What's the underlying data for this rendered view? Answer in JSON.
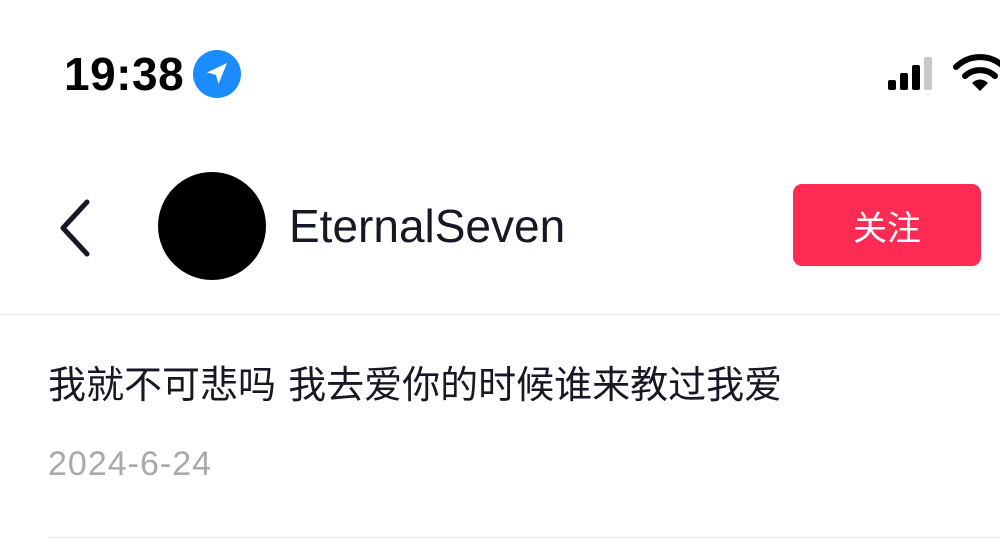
{
  "status_bar": {
    "time": "19:38",
    "location_icon": "location-arrow-icon",
    "signal_icon": "cellular-signal-icon",
    "wifi_icon": "wifi-icon"
  },
  "header": {
    "back_icon": "chevron-left-icon",
    "username": "EternalSeven",
    "follow_label": "关注"
  },
  "post": {
    "text": "我就不可悲吗  我去爱你的时候谁来教过我爱",
    "date": "2024-6-24"
  },
  "colors": {
    "accent": "#fe2c55",
    "location_blue": "#1a8cff",
    "text_primary": "#161823",
    "text_secondary": "#a8a8ad",
    "divider": "#e6e6e8"
  }
}
